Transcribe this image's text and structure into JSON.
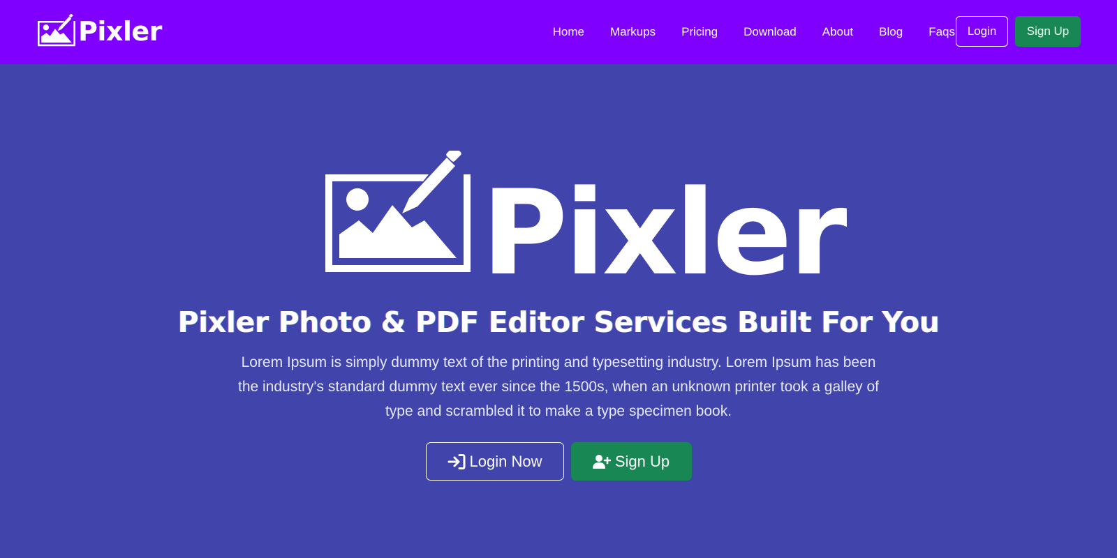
{
  "navbar": {
    "brand": "Pixler",
    "brand_icon": "image-edit-icon",
    "links": [
      "Home",
      "Markups",
      "Pricing",
      "Download",
      "About",
      "Blog",
      "Faqs"
    ],
    "login_label": "Login",
    "signup_label": "Sign Up"
  },
  "hero": {
    "logo_text": "Pixler",
    "logo_icon": "image-edit-icon",
    "title": "Pixler Photo & PDF Editor Services Built For You",
    "description": "Lorem Ipsum is simply dummy text of the printing and typesetting industry. Lorem Ipsum has been the industry's standard dummy text ever since the 1500s, when an unknown printer took a galley of type and scrambled it to make a type specimen book.",
    "login_button": {
      "label": "Login Now",
      "icon": "sign-in-icon"
    },
    "signup_button": {
      "label": "Sign Up",
      "icon": "user-plus-icon"
    }
  },
  "colors": {
    "navbar_bg": "#8000ff",
    "hero_bg": "#4044ab",
    "success": "#198754",
    "text": "#ffffff"
  }
}
